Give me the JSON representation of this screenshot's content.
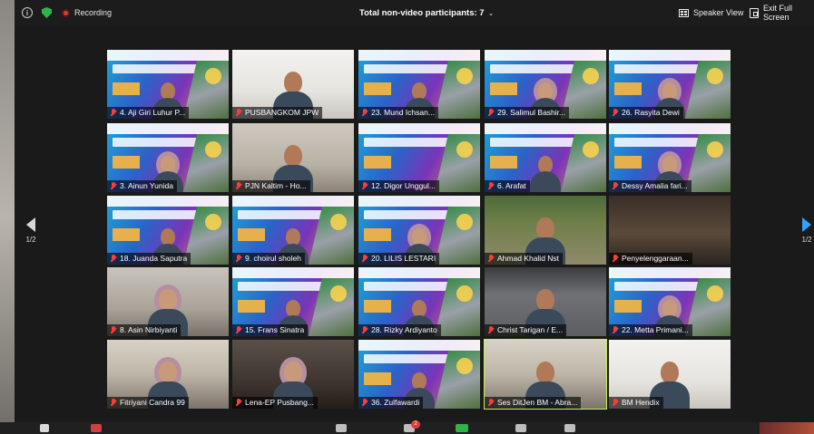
{
  "topbar": {
    "recording_label": "Recording",
    "participants_label": "Total non-video participants: 7",
    "speaker_view_label": "Speaker View",
    "exit_fullscreen_label": "Exit Full Screen"
  },
  "pagination": {
    "left": "1/2",
    "right": "1/2"
  },
  "tiles": [
    {
      "name": "4. Aji Giri Luhur P..."
    },
    {
      "name": "PUSBANGKOM JPW"
    },
    {
      "name": "23. Mund Ichsan..."
    },
    {
      "name": "29. Salimul Bashir..."
    },
    {
      "name": "26. Rasyita Dewi"
    },
    {
      "name": "3. Ainun Yunida"
    },
    {
      "name": "PJN Kaltim - Ho..."
    },
    {
      "name": "12. Digor Unggul..."
    },
    {
      "name": "6. Arafat"
    },
    {
      "name": "Dessy Amalia fari..."
    },
    {
      "name": "18. Juanda Saputra"
    },
    {
      "name": "9. choirul sholeh"
    },
    {
      "name": "20. LILIS LESTARI"
    },
    {
      "name": "Ahmad Khalid Nst"
    },
    {
      "name": "Penyelenggaraan..."
    },
    {
      "name": "8. Asin Nirbiyanti"
    },
    {
      "name": "15. Frans Sinatra"
    },
    {
      "name": "28. Rizky Ardiyanto"
    },
    {
      "name": "Christ Tarigan / E..."
    },
    {
      "name": "22. Metta Primani..."
    },
    {
      "name": "Fitriyani Candra 99"
    },
    {
      "name": "Lena-EP Pusbang..."
    },
    {
      "name": "36. Zulfawardi"
    },
    {
      "name": "Ses DitJen BM - Abra..."
    },
    {
      "name": "BM Hendix"
    }
  ],
  "bottombar": {
    "chat_badge": "2"
  },
  "colors": {
    "active_speaker": "#c7ef5b",
    "muted": "#ff3b3b",
    "topbar": "#1c1c1c"
  }
}
